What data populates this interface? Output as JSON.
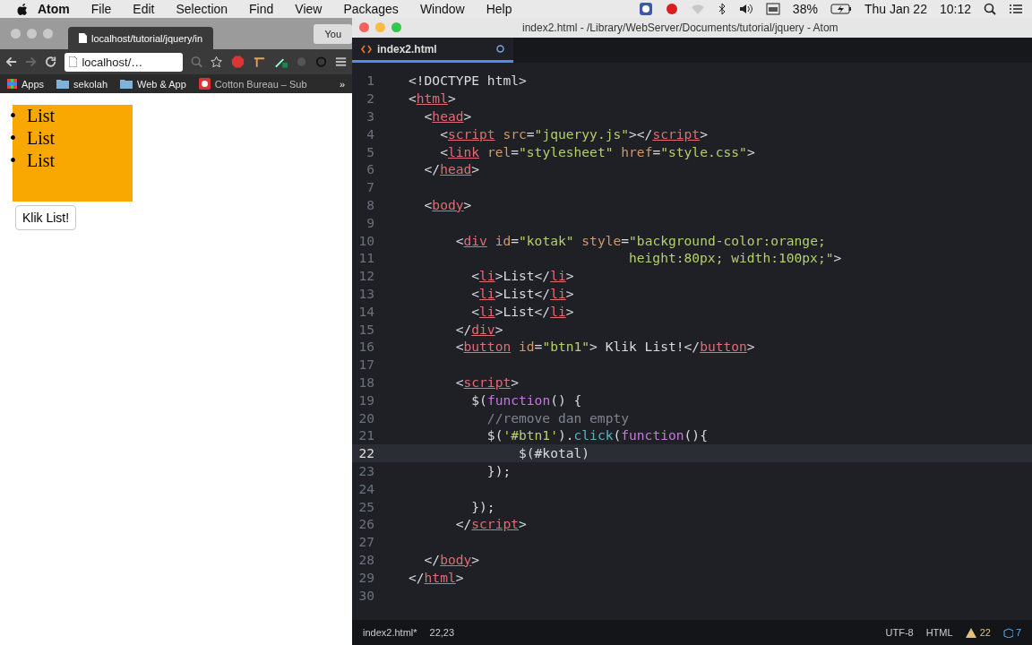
{
  "menu_bar": {
    "app": "Atom",
    "items": [
      "File",
      "Edit",
      "Selection",
      "Find",
      "View",
      "Packages",
      "Window",
      "Help"
    ],
    "battery": "38%",
    "date": "Thu Jan 22",
    "time": "10:12"
  },
  "browser": {
    "tabs": [
      {
        "label": "localhost/tutorial/jquery/in",
        "selected": true
      },
      {
        "label": "You",
        "selected": false
      }
    ],
    "address": "localhost/…",
    "bookmarks": [
      "Apps",
      "sekolah",
      "Web & App",
      "Cotton Bureau – Sub"
    ],
    "bookmarks_more": "»",
    "page": {
      "list_items": [
        {
          "bullet": "•",
          "text": "List"
        },
        {
          "bullet": "•",
          "text": "List"
        },
        {
          "bullet": "•",
          "text": "List"
        }
      ],
      "button": "Klik List!"
    }
  },
  "editor": {
    "window_title": "index2.html - /Library/WebServer/Documents/tutorial/jquery - Atom",
    "tabs": [
      {
        "label": "index2.html",
        "selected": true,
        "modified": true
      }
    ],
    "lines": [
      {
        "number": "1",
        "selected": false,
        "tokens": [
          {
            "text": "<!DOCTYPE html>",
            "kind": "plain"
          }
        ]
      },
      {
        "number": "2",
        "selected": false,
        "tokens": [
          {
            "text": "<",
            "kind": "plain"
          },
          {
            "text": "html",
            "kind": "tag"
          },
          {
            "text": ">",
            "kind": "plain"
          }
        ]
      },
      {
        "number": "3",
        "selected": false,
        "tokens": [
          {
            "text": "  <",
            "kind": "plain"
          },
          {
            "text": "head",
            "kind": "tag"
          },
          {
            "text": ">",
            "kind": "plain"
          }
        ]
      },
      {
        "number": "4",
        "selected": false,
        "tokens": [
          {
            "text": "    <",
            "kind": "plain"
          },
          {
            "text": "script",
            "kind": "tag"
          },
          {
            "text": " src",
            "kind": "attr"
          },
          {
            "text": "=",
            "kind": "plain"
          },
          {
            "text": "\"jqueryy.js\"",
            "kind": "string"
          },
          {
            "text": "></",
            "kind": "plain"
          },
          {
            "text": "script",
            "kind": "tag"
          },
          {
            "text": ">",
            "kind": "plain"
          }
        ]
      },
      {
        "number": "5",
        "selected": false,
        "tokens": [
          {
            "text": "    <",
            "kind": "plain"
          },
          {
            "text": "link",
            "kind": "tag"
          },
          {
            "text": " rel",
            "kind": "attr"
          },
          {
            "text": "=",
            "kind": "plain"
          },
          {
            "text": "\"stylesheet\"",
            "kind": "string"
          },
          {
            "text": " href",
            "kind": "attr"
          },
          {
            "text": "=",
            "kind": "plain"
          },
          {
            "text": "\"style.css\"",
            "kind": "string"
          },
          {
            "text": ">",
            "kind": "plain"
          }
        ]
      },
      {
        "number": "6",
        "selected": false,
        "tokens": [
          {
            "text": "  </",
            "kind": "plain"
          },
          {
            "text": "head",
            "kind": "tag"
          },
          {
            "text": ">",
            "kind": "plain"
          }
        ]
      },
      {
        "number": "7",
        "selected": false
      },
      {
        "number": "8",
        "selected": false,
        "tokens": [
          {
            "text": "  <",
            "kind": "plain"
          },
          {
            "text": "body",
            "kind": "tag"
          },
          {
            "text": ">",
            "kind": "plain"
          }
        ]
      },
      {
        "number": "9",
        "selected": false
      },
      {
        "number": "10",
        "selected": false,
        "tokens": [
          {
            "text": "      <",
            "kind": "plain"
          },
          {
            "text": "div",
            "kind": "tag"
          },
          {
            "text": " id",
            "kind": "attr"
          },
          {
            "text": "=",
            "kind": "plain"
          },
          {
            "text": "\"kotak\"",
            "kind": "string"
          },
          {
            "text": " style",
            "kind": "attr"
          },
          {
            "text": "=",
            "kind": "plain"
          },
          {
            "text": "\"background-color:orange;",
            "kind": "string"
          }
        ]
      },
      {
        "number": "11",
        "selected": false,
        "tokens": [
          {
            "text": "                            height:80px; width:100px;\"",
            "kind": "string"
          },
          {
            "text": ">",
            "kind": "plain"
          }
        ]
      },
      {
        "number": "12",
        "selected": false,
        "tokens": [
          {
            "text": "        <",
            "kind": "plain"
          },
          {
            "text": "li",
            "kind": "tag"
          },
          {
            "text": ">List</",
            "kind": "plain"
          },
          {
            "text": "li",
            "kind": "tag"
          },
          {
            "text": ">",
            "kind": "plain"
          }
        ]
      },
      {
        "number": "13",
        "selected": false,
        "tokens": [
          {
            "text": "        <",
            "kind": "plain"
          },
          {
            "text": "li",
            "kind": "tag"
          },
          {
            "text": ">List</",
            "kind": "plain"
          },
          {
            "text": "li",
            "kind": "tag"
          },
          {
            "text": ">",
            "kind": "plain"
          }
        ]
      },
      {
        "number": "14",
        "selected": false,
        "tokens": [
          {
            "text": "        <",
            "kind": "plain"
          },
          {
            "text": "li",
            "kind": "tag"
          },
          {
            "text": ">List</",
            "kind": "plain"
          },
          {
            "text": "li",
            "kind": "tag"
          },
          {
            "text": ">",
            "kind": "plain"
          }
        ]
      },
      {
        "number": "15",
        "selected": false,
        "tokens": [
          {
            "text": "      </",
            "kind": "plain"
          },
          {
            "text": "div",
            "kind": "tag"
          },
          {
            "text": ">",
            "kind": "plain"
          }
        ]
      },
      {
        "number": "16",
        "selected": false,
        "tokens": [
          {
            "text": "      <",
            "kind": "plain"
          },
          {
            "text": "button",
            "kind": "tag"
          },
          {
            "text": " id",
            "kind": "attr"
          },
          {
            "text": "=",
            "kind": "plain"
          },
          {
            "text": "\"btn1\"",
            "kind": "string"
          },
          {
            "text": "> Klik List!</",
            "kind": "plain"
          },
          {
            "text": "button",
            "kind": "tag"
          },
          {
            "text": ">",
            "kind": "plain"
          }
        ]
      },
      {
        "number": "17",
        "selected": false
      },
      {
        "number": "18",
        "selected": false,
        "tokens": [
          {
            "text": "      <",
            "kind": "plain"
          },
          {
            "text": "script",
            "kind": "tag"
          },
          {
            "text": ">",
            "kind": "plain"
          }
        ]
      },
      {
        "number": "19",
        "selected": false,
        "tokens": [
          {
            "text": "        $(",
            "kind": "plain"
          },
          {
            "text": "function",
            "kind": "keyword"
          },
          {
            "text": "() {",
            "kind": "plain"
          }
        ]
      },
      {
        "number": "20",
        "selected": false,
        "tokens": [
          {
            "text": "          //remove dan empty",
            "kind": "comment"
          }
        ]
      },
      {
        "number": "21",
        "selected": false,
        "tokens": [
          {
            "text": "          $(",
            "kind": "plain"
          },
          {
            "text": "'#btn1'",
            "kind": "string"
          },
          {
            "text": ").",
            "kind": "plain"
          },
          {
            "text": "click",
            "kind": "method"
          },
          {
            "text": "(",
            "kind": "plain"
          },
          {
            "text": "function",
            "kind": "keyword"
          },
          {
            "text": "(){",
            "kind": "plain"
          }
        ]
      },
      {
        "number": "22",
        "selected": true,
        "tokens": [
          {
            "text": "              $(#kotal)",
            "kind": "plain"
          }
        ]
      },
      {
        "number": "23",
        "selected": false,
        "tokens": [
          {
            "text": "          });",
            "kind": "plain"
          }
        ]
      },
      {
        "number": "24",
        "selected": false
      },
      {
        "number": "25",
        "selected": false,
        "tokens": [
          {
            "text": "        });",
            "kind": "plain"
          }
        ]
      },
      {
        "number": "26",
        "selected": false,
        "tokens": [
          {
            "text": "      </",
            "kind": "plain"
          },
          {
            "text": "script",
            "kind": "tag"
          },
          {
            "text": ">",
            "kind": "plain"
          }
        ]
      },
      {
        "number": "27",
        "selected": false
      },
      {
        "number": "28",
        "selected": false,
        "tokens": [
          {
            "text": "  </",
            "kind": "plain"
          },
          {
            "text": "body",
            "kind": "tag"
          },
          {
            "text": ">",
            "kind": "plain"
          }
        ]
      },
      {
        "number": "29",
        "selected": false,
        "tokens": [
          {
            "text": "</",
            "kind": "plain"
          },
          {
            "text": "html",
            "kind": "tag"
          },
          {
            "text": ">",
            "kind": "plain"
          }
        ]
      },
      {
        "number": "30",
        "selected": false
      }
    ],
    "status_bar": {
      "file": "index2.html*",
      "cursor": "22,23",
      "encoding": "UTF-8",
      "grammar": "HTML",
      "warnings": "22",
      "packages": "7"
    }
  }
}
